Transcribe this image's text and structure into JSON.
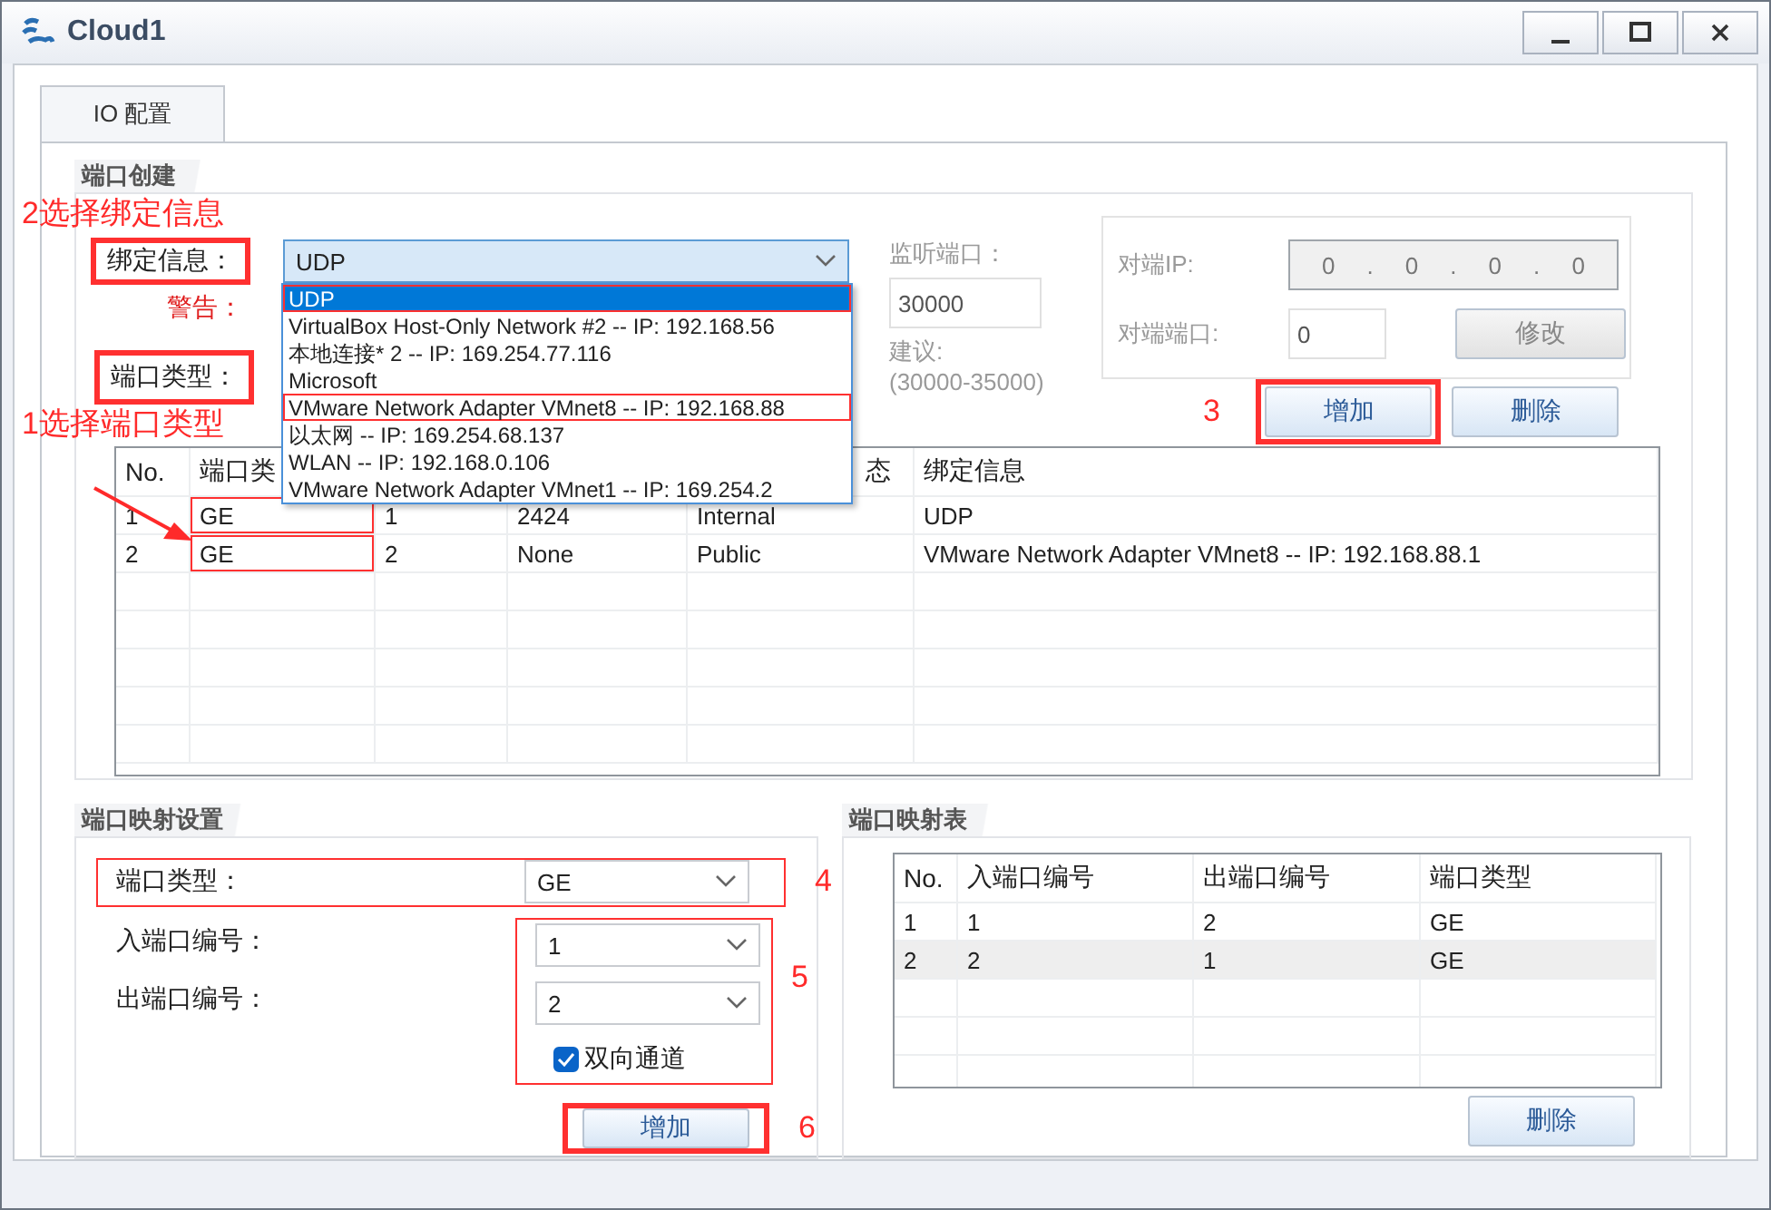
{
  "window": {
    "title": "Cloud1"
  },
  "tabs": [
    {
      "label": "IO 配置",
      "selected": true
    }
  ],
  "port_creation": {
    "title": "端口创建",
    "binding_note": "2选择绑定信息",
    "binding_marked": true,
    "binding_label": "绑定信息：",
    "binding_value": "UDP",
    "warning_label": "警告：",
    "port_type_label": "端口类型：",
    "port_type_marked": true,
    "port_type_note": "1选择端口类型",
    "type_arrow": true,
    "listen_port_label": "监听端口：",
    "listen_port_value": "30000",
    "hint_label": "建议:",
    "hint_range": "(30000-35000)",
    "peer_ip_label": "对端IP:",
    "peer_ip_octets": [
      "0",
      "0",
      "0",
      "0"
    ],
    "peer_ip_separator": ".",
    "peer_port_label": "对端端口:",
    "peer_port_value": "0",
    "modify_button": {
      "label": "修改",
      "disabled": true
    },
    "add_note": "3",
    "add_marked": true,
    "add_button": "增加",
    "delete_button": "删除",
    "dropdown": [
      {
        "label": "UDP",
        "selected": true,
        "marked": true
      },
      {
        "label": "VirtualBox Host-Only Network #2 -- IP: 192.168.56",
        "selected": false,
        "marked": false
      },
      {
        "label": "本地连接* 2 -- IP: 169.254.77.116",
        "selected": false,
        "marked": false
      },
      {
        "label": "Microsoft",
        "selected": false,
        "marked": false
      },
      {
        "label": "VMware Network Adapter VMnet8 -- IP: 192.168.88",
        "selected": false,
        "marked": true
      },
      {
        "label": "以太网 -- IP: 169.254.68.137",
        "selected": false,
        "marked": false
      },
      {
        "label": "WLAN -- IP: 192.168.0.106",
        "selected": false,
        "marked": false
      },
      {
        "label": "VMware Network Adapter VMnet1 -- IP: 169.254.2",
        "selected": false,
        "marked": false
      }
    ],
    "table": {
      "columns": [
        "No.",
        "端口类",
        "",
        "",
        "态",
        "绑定信息"
      ],
      "rows": [
        {
          "cells": [
            "1",
            "GE",
            "1",
            "2424",
            "Internal",
            "UDP"
          ],
          "type_marked": true
        },
        {
          "cells": [
            "2",
            "GE",
            "2",
            "None",
            "Public",
            "VMware Network Adapter VMnet8 -- IP: 192.168.88.1"
          ],
          "type_marked": true
        }
      ]
    }
  },
  "mapping_settings": {
    "title": "端口映射设置",
    "fields": [
      {
        "label": "端口类型：",
        "value": "GE"
      },
      {
        "label": "入端口编号：",
        "value": "1"
      },
      {
        "label": "出端口编号：",
        "value": "2"
      }
    ],
    "type_marked": true,
    "type_note": "4",
    "selection_marked": true,
    "selection_note": "5",
    "bidirectional": {
      "label": "双向通道",
      "checked": true
    },
    "add_marked": true,
    "add_note": "6",
    "add_button": "增加"
  },
  "mapping_table": {
    "title": "端口映射表",
    "columns": [
      "No.",
      "入端口编号",
      "出端口编号",
      "端口类型"
    ],
    "rows": [
      {
        "cells": [
          "1",
          "1",
          "2",
          "GE"
        ],
        "selected": false
      },
      {
        "cells": [
          "2",
          "2",
          "1",
          "GE"
        ],
        "selected": true
      }
    ],
    "delete_button": "删除"
  }
}
